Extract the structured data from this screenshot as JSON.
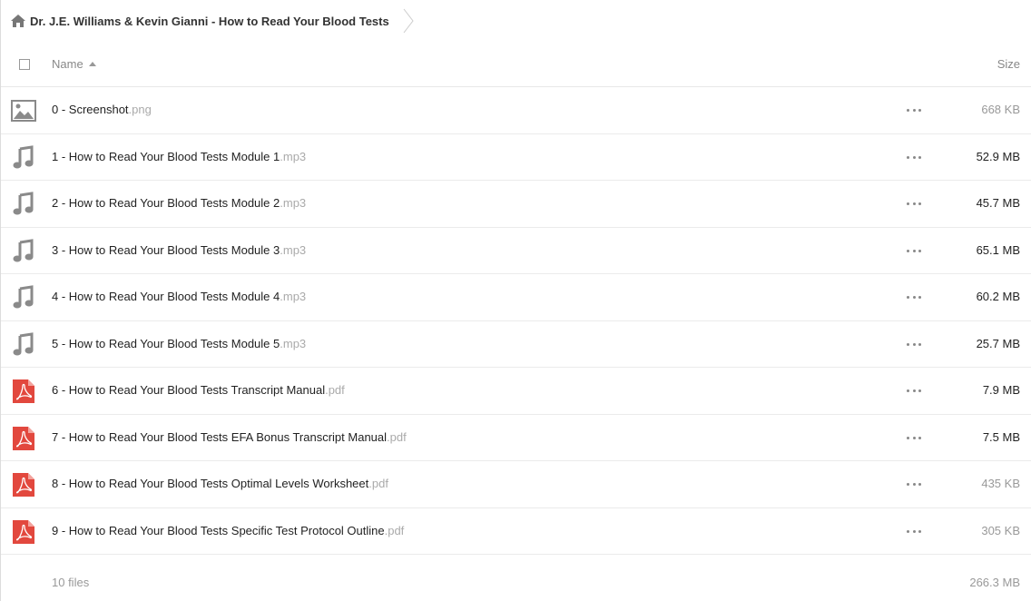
{
  "breadcrumb": {
    "icon": "home-icon",
    "label": "Dr. J.E. Williams & Kevin Gianni - How to Read Your Blood Tests"
  },
  "header": {
    "name_label": "Name",
    "size_label": "Size"
  },
  "files": [
    {
      "base": "0 - Screenshot",
      "ext": ".png",
      "size": "668 KB",
      "type": "image-icon",
      "size_emph": false
    },
    {
      "base": "1 - How to Read Your Blood Tests Module 1",
      "ext": ".mp3",
      "size": "52.9 MB",
      "type": "music-icon",
      "size_emph": true
    },
    {
      "base": "2 - How to Read Your Blood Tests Module 2",
      "ext": ".mp3",
      "size": "45.7 MB",
      "type": "music-icon",
      "size_emph": true
    },
    {
      "base": "3 - How to Read Your Blood Tests Module 3",
      "ext": ".mp3",
      "size": "65.1 MB",
      "type": "music-icon",
      "size_emph": true
    },
    {
      "base": "4 - How to Read Your Blood Tests Module 4",
      "ext": ".mp3",
      "size": "60.2 MB",
      "type": "music-icon",
      "size_emph": true
    },
    {
      "base": "5 - How to Read Your Blood Tests Module 5",
      "ext": ".mp3",
      "size": "25.7 MB",
      "type": "music-icon",
      "size_emph": true
    },
    {
      "base": "6 - How to Read Your Blood Tests Transcript Manual",
      "ext": ".pdf",
      "size": "7.9 MB",
      "type": "pdf-icon",
      "size_emph": true
    },
    {
      "base": "7 - How to Read Your Blood Tests EFA Bonus Transcript Manual",
      "ext": ".pdf",
      "size": "7.5 MB",
      "type": "pdf-icon",
      "size_emph": true
    },
    {
      "base": "8 - How to Read Your Blood Tests Optimal Levels Worksheet",
      "ext": ".pdf",
      "size": "435 KB",
      "type": "pdf-icon",
      "size_emph": false
    },
    {
      "base": "9 - How to Read Your Blood Tests Specific Test Protocol Outline",
      "ext": ".pdf",
      "size": "305 KB",
      "type": "pdf-icon",
      "size_emph": false
    }
  ],
  "summary": {
    "count": "10 files",
    "total": "266.3 MB"
  },
  "colors": {
    "pdf": "#e2483e",
    "icon_gray": "#8a8a8a"
  }
}
